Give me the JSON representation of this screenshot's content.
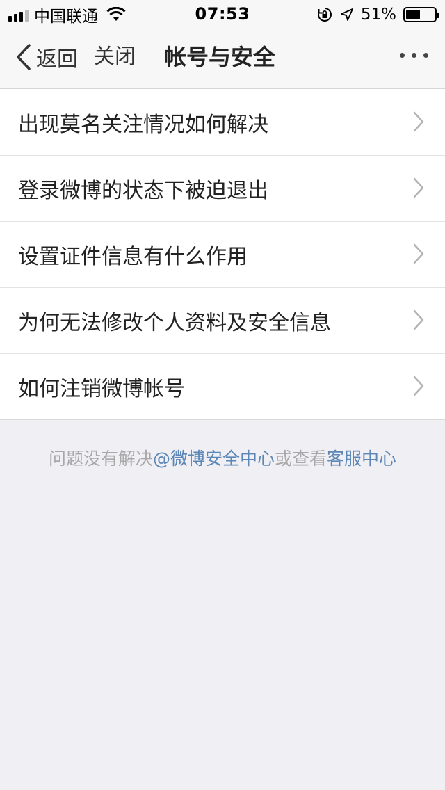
{
  "status_bar": {
    "carrier": "中国联通",
    "time": "07:53",
    "battery_percent": "51%",
    "battery_level": 0.51,
    "icons": [
      "signal-icon",
      "wifi-icon",
      "orientation-lock-icon",
      "location-icon",
      "battery-icon"
    ]
  },
  "nav": {
    "back_label": "返回",
    "close_label": "关闭",
    "title": "帐号与安全",
    "more_icon": "more-dots-icon"
  },
  "list": {
    "items": [
      {
        "label": "出现莫名关注情况如何解决"
      },
      {
        "label": "登录微博的状态下被迫退出"
      },
      {
        "label": "设置证件信息有什么作用"
      },
      {
        "label": "为何无法修改个人资料及安全信息"
      },
      {
        "label": "如何注销微博帐号"
      }
    ]
  },
  "help": {
    "prefix": "问题没有解决",
    "link_security": "@微博安全中心",
    "middle": "或查看",
    "link_service": "客服中心"
  },
  "colors": {
    "background": "#efeff4",
    "link": "#5b86b5",
    "muted_text": "#a8a8a8"
  }
}
